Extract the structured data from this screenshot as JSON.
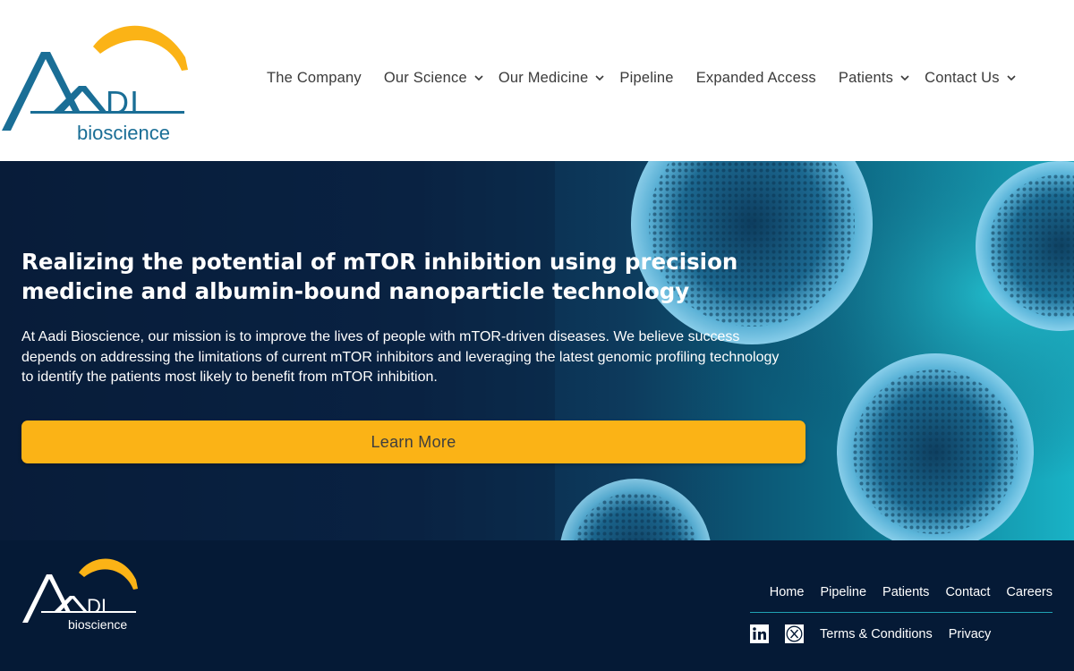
{
  "brand": {
    "logo_text": "bioscience",
    "logo_mark": "AADI",
    "colors": {
      "primary_blue": "#1a6e96",
      "accent_gold": "#fbb316",
      "navy": "#051a36",
      "teal": "#1fa2b3"
    }
  },
  "nav": {
    "items": [
      {
        "label": "The Company",
        "has_dropdown": false
      },
      {
        "label": "Our Science",
        "has_dropdown": true
      },
      {
        "label": "Our Medicine",
        "has_dropdown": true
      },
      {
        "label": "Pipeline",
        "has_dropdown": false
      },
      {
        "label": "Expanded Access",
        "has_dropdown": false
      },
      {
        "label": "Patients",
        "has_dropdown": true
      },
      {
        "label": "Contact Us",
        "has_dropdown": true
      }
    ]
  },
  "hero": {
    "title": "Realizing the potential of mTOR inhibition using precision medicine and albumin-bound nanoparticle technology",
    "text": "At Aadi Bioscience, our mission is to improve the lives of people with mTOR-driven diseases. We believe success depends on addressing the limitations of current mTOR inhibitors and leveraging the latest genomic profiling technology to identify the patients most likely to benefit from mTOR inhibition.",
    "button_label": "Learn More"
  },
  "footer": {
    "links": [
      "Home",
      "Pipeline",
      "Patients",
      "Contact",
      "Careers"
    ],
    "social": [
      "linkedin-icon",
      "x-icon"
    ],
    "terms_label": "Terms & Conditions",
    "privacy_label": "Privacy"
  }
}
